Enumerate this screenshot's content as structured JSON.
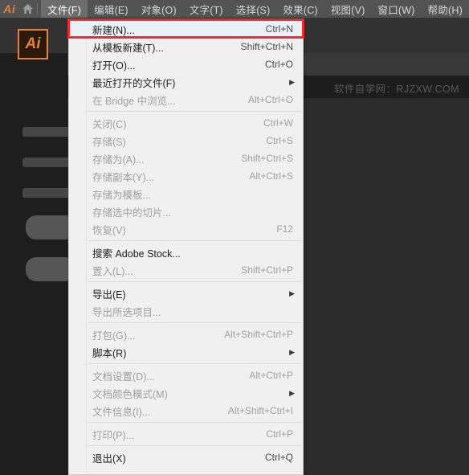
{
  "app": {
    "logo_text": "Ai",
    "home_icon": "home-icon",
    "canvas_tile_text": "Ai",
    "watermark": "软件自学网：RJZXW.COM"
  },
  "menubar": {
    "items": [
      {
        "label": "文件(F)",
        "active": true
      },
      {
        "label": "编辑(E)",
        "active": false
      },
      {
        "label": "对象(O)",
        "active": false
      },
      {
        "label": "文字(T)",
        "active": false
      },
      {
        "label": "选择(S)",
        "active": false
      },
      {
        "label": "效果(C)",
        "active": false
      },
      {
        "label": "视图(V)",
        "active": false
      },
      {
        "label": "窗口(W)",
        "active": false
      },
      {
        "label": "帮助(H)",
        "active": false
      }
    ]
  },
  "file_menu": {
    "items": [
      {
        "type": "item",
        "label": "新建(N)...",
        "accel": "Ctrl+N",
        "disabled": false,
        "submenu": false,
        "selected": true
      },
      {
        "type": "item",
        "label": "从模板新建(T)...",
        "accel": "Shift+Ctrl+N",
        "disabled": false,
        "submenu": false,
        "selected": false
      },
      {
        "type": "item",
        "label": "打开(O)...",
        "accel": "Ctrl+O",
        "disabled": false,
        "submenu": false,
        "selected": false
      },
      {
        "type": "item",
        "label": "最近打开的文件(F)",
        "accel": "",
        "disabled": false,
        "submenu": true,
        "selected": false
      },
      {
        "type": "item",
        "label": "在 Bridge 中浏览...",
        "accel": "Alt+Ctrl+O",
        "disabled": true,
        "submenu": false,
        "selected": false
      },
      {
        "type": "separator"
      },
      {
        "type": "item",
        "label": "关闭(C)",
        "accel": "Ctrl+W",
        "disabled": true,
        "submenu": false,
        "selected": false
      },
      {
        "type": "item",
        "label": "存储(S)",
        "accel": "Ctrl+S",
        "disabled": true,
        "submenu": false,
        "selected": false
      },
      {
        "type": "item",
        "label": "存储为(A)...",
        "accel": "Shift+Ctrl+S",
        "disabled": true,
        "submenu": false,
        "selected": false
      },
      {
        "type": "item",
        "label": "存储副本(Y)...",
        "accel": "Alt+Ctrl+S",
        "disabled": true,
        "submenu": false,
        "selected": false
      },
      {
        "type": "item",
        "label": "存储为模板...",
        "accel": "",
        "disabled": true,
        "submenu": false,
        "selected": false
      },
      {
        "type": "item",
        "label": "存储选中的切片...",
        "accel": "",
        "disabled": true,
        "submenu": false,
        "selected": false
      },
      {
        "type": "item",
        "label": "恢复(V)",
        "accel": "F12",
        "disabled": true,
        "submenu": false,
        "selected": false
      },
      {
        "type": "separator"
      },
      {
        "type": "item",
        "label": "搜索 Adobe Stock...",
        "accel": "",
        "disabled": false,
        "submenu": false,
        "selected": false
      },
      {
        "type": "item",
        "label": "置入(L)...",
        "accel": "Shift+Ctrl+P",
        "disabled": true,
        "submenu": false,
        "selected": false
      },
      {
        "type": "separator"
      },
      {
        "type": "item",
        "label": "导出(E)",
        "accel": "",
        "disabled": false,
        "submenu": true,
        "selected": false
      },
      {
        "type": "item",
        "label": "导出所选项目...",
        "accel": "",
        "disabled": true,
        "submenu": false,
        "selected": false
      },
      {
        "type": "separator"
      },
      {
        "type": "item",
        "label": "打包(G)...",
        "accel": "Alt+Shift+Ctrl+P",
        "disabled": true,
        "submenu": false,
        "selected": false
      },
      {
        "type": "item",
        "label": "脚本(R)",
        "accel": "",
        "disabled": false,
        "submenu": true,
        "selected": false
      },
      {
        "type": "separator"
      },
      {
        "type": "item",
        "label": "文档设置(D)...",
        "accel": "Alt+Ctrl+P",
        "disabled": true,
        "submenu": false,
        "selected": false
      },
      {
        "type": "item",
        "label": "文档颜色模式(M)",
        "accel": "",
        "disabled": true,
        "submenu": true,
        "selected": false
      },
      {
        "type": "item",
        "label": "文件信息(I)...",
        "accel": "Alt+Shift+Ctrl+I",
        "disabled": true,
        "submenu": false,
        "selected": false
      },
      {
        "type": "separator"
      },
      {
        "type": "item",
        "label": "打印(P)...",
        "accel": "Ctrl+P",
        "disabled": true,
        "submenu": false,
        "selected": false
      },
      {
        "type": "separator"
      },
      {
        "type": "item",
        "label": "退出(X)",
        "accel": "Ctrl+Q",
        "disabled": false,
        "submenu": false,
        "selected": false
      }
    ]
  },
  "annotation": {
    "highlight_color": "#f3292a",
    "highlight_target": "新建(N)..."
  },
  "colors": {
    "menubar_bg": "#535353",
    "menubar_active_bg": "#6d6d6d",
    "panel_bg": "#f0f0f0",
    "workspace_bg": "#2b2b2b",
    "accent_orange": "#e2823c"
  }
}
